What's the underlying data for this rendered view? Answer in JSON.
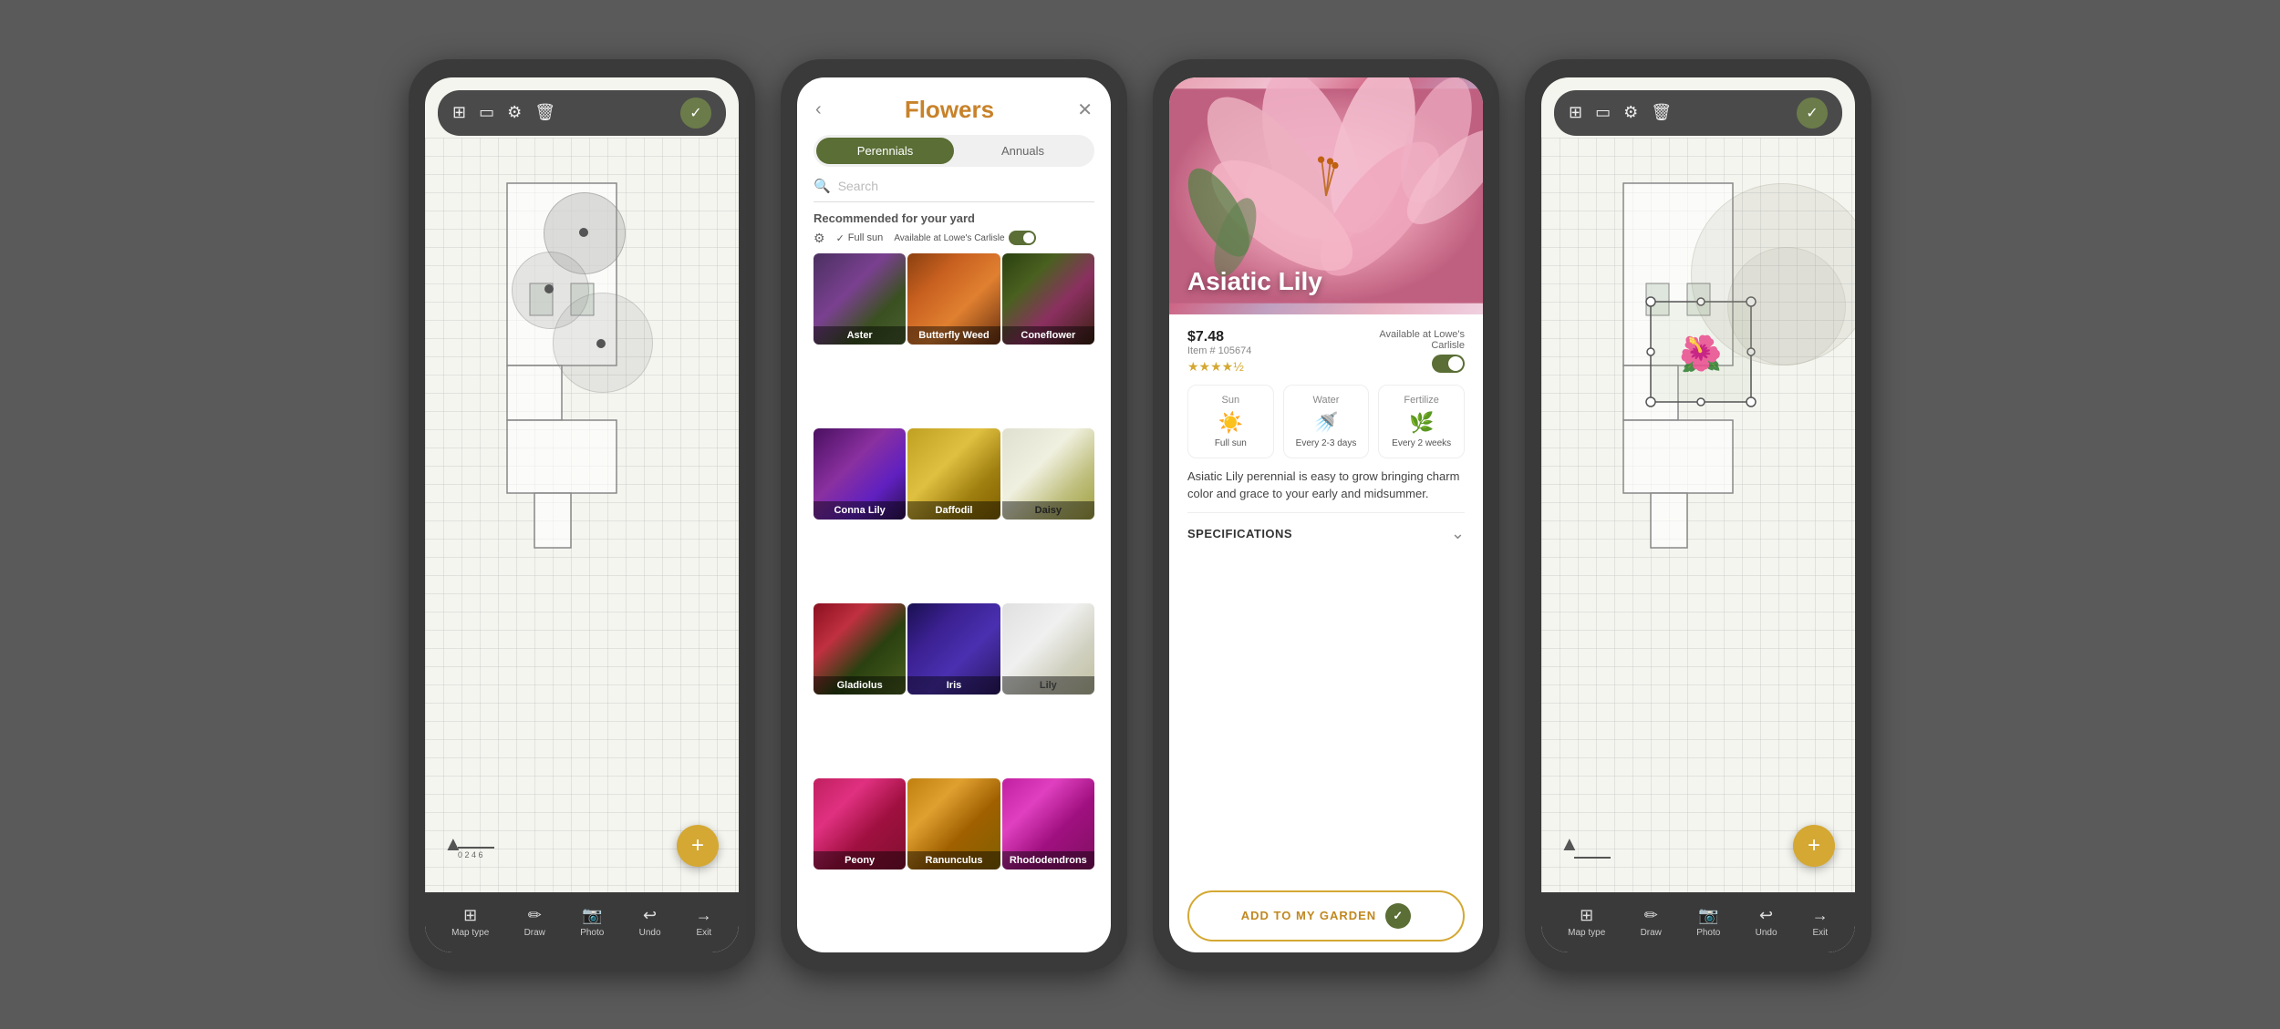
{
  "screen1": {
    "toolbar": {
      "layers_icon": "⊞",
      "phone_icon": "▭",
      "sliders_icon": "≡",
      "trash_icon": "🗑",
      "check_icon": "✓"
    },
    "bottom_nav": [
      {
        "icon": "⊞",
        "label": "Map type"
      },
      {
        "icon": "✏",
        "label": "Draw"
      },
      {
        "icon": "📷",
        "label": "Photo"
      },
      {
        "icon": "↩",
        "label": "Undo"
      },
      {
        "icon": "→",
        "label": "Exit"
      }
    ]
  },
  "screen2": {
    "title": "Flowers",
    "tabs": [
      "Perennials",
      "Annuals"
    ],
    "active_tab": "Perennials",
    "search_placeholder": "Search",
    "recommended_label": "Recommended for your yard",
    "filter_sun": "Full sun",
    "filter_store": "Available at Lowe's Carlisle",
    "flowers": [
      {
        "name": "Aster",
        "class": "flower-aster"
      },
      {
        "name": "Butterfly Weed",
        "class": "flower-butterfly"
      },
      {
        "name": "Coneflower",
        "class": "flower-coneflower"
      },
      {
        "name": "Conna Lily",
        "class": "flower-conna"
      },
      {
        "name": "Daffodil",
        "class": "flower-daffodil"
      },
      {
        "name": "Daisy",
        "class": "flower-daisy"
      },
      {
        "name": "Gladiolus",
        "class": "flower-gladiolus"
      },
      {
        "name": "Iris",
        "class": "flower-iris"
      },
      {
        "name": "Lily",
        "class": "flower-lily"
      },
      {
        "name": "Peony",
        "class": "flower-peony"
      },
      {
        "name": "Ranunculus",
        "class": "flower-ranunculus"
      },
      {
        "name": "Rhododendrons",
        "class": "flower-rhodo"
      }
    ]
  },
  "screen3": {
    "plant_name": "Asiatic Lily",
    "price": "$7.48",
    "item_number": "Item # 105674",
    "stars": "★★★★½",
    "available_label": "Available at Lowe's",
    "available_store": "Carlisle",
    "care": [
      {
        "title": "Sun",
        "icon": "☀",
        "value": "Full sun"
      },
      {
        "title": "Water",
        "icon": "💧",
        "value": "Every 2-3 days"
      },
      {
        "title": "Fertilize",
        "icon": "🌱",
        "value": "Every 2 weeks"
      }
    ],
    "description": "Asiatic Lily perennial is easy to grow bringing charm color and grace to your early and midsummer.",
    "specs_label": "SPECIFICATIONS",
    "add_button": "ADD TO MY GARDEN",
    "check_icon": "✓"
  },
  "screen4": {
    "toolbar": {
      "layers_icon": "⊞",
      "phone_icon": "▭",
      "sliders_icon": "≡",
      "trash_icon": "🗑",
      "check_icon": "✓"
    },
    "bottom_nav": [
      {
        "icon": "⊞",
        "label": "Map type"
      },
      {
        "icon": "✏",
        "label": "Draw"
      },
      {
        "icon": "📷",
        "label": "Photo"
      },
      {
        "icon": "↩",
        "label": "Undo"
      },
      {
        "icon": "→",
        "label": "Exit"
      }
    ]
  }
}
